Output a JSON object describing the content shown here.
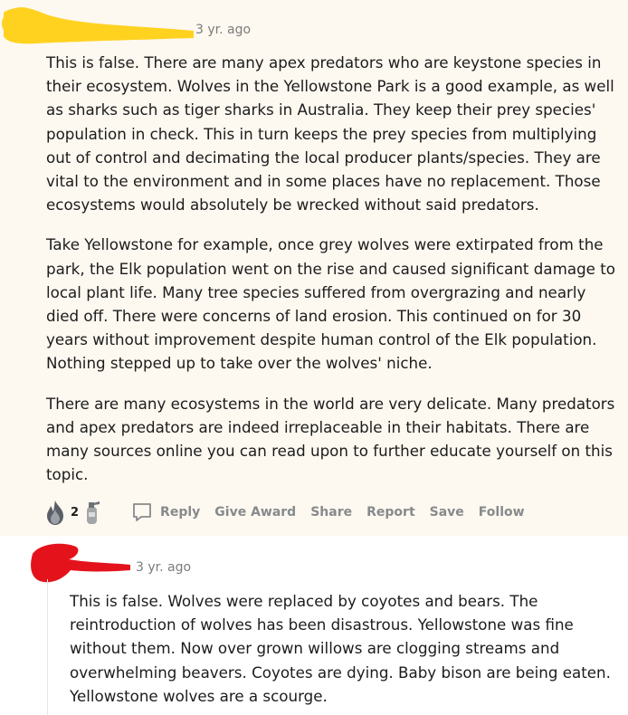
{
  "comment1": {
    "timestamp": "3 yr. ago",
    "paragraphs": [
      "This is false. There are many apex predators who are keystone species in their ecosystem. Wolves in the Yellowstone Park is a good example, as well as sharks such as tiger sharks in Australia. They keep their prey species' population in check. This in turn keeps the prey species from multiplying out of control and decimating the local producer plants/species. They are vital to the environment and in some places have no replacement. Those ecosystems would absolutely be wrecked without said predators.",
      "Take Yellowstone for example, once grey wolves were extirpated from the park, the Elk population went on the rise and caused significant damage to local plant life. Many tree species suffered from overgrazing and nearly died off. There were concerns of land erosion. This continued on for 30 years without improvement despite human control of the Elk population. Nothing stepped up to take over the wolves' niche.",
      "There are many ecosystems in the world are very delicate. Many predators and apex predators are indeed irreplaceable in their habitats. There are many sources online you can read upon to further educate yourself on this topic."
    ],
    "awards": {
      "count": "2"
    },
    "actions": {
      "reply": "Reply",
      "give_award": "Give Award",
      "share": "Share",
      "report": "Report",
      "save": "Save",
      "follow": "Follow"
    }
  },
  "comment2": {
    "timestamp": "3 yr. ago",
    "paragraphs": [
      "This is false. Wolves were replaced by coyotes and bears. The reintroduction of wolves has been disastrous. Yellowstone was fine without them. Now over grown willows are clogging streams and overwhelming beavers. Coyotes are dying. Baby bison are being eaten. Yellowstone wolves are a scourge."
    ]
  },
  "icons": [
    "fire-award-icon",
    "fire-extinguisher-award-icon",
    "comment-bubble-icon"
  ],
  "colors": {
    "highlight_bg": "#fdf8f0",
    "redaction_yellow": "#ffd21f",
    "redaction_red": "#e4131b",
    "action_gray": "#878a8c"
  }
}
